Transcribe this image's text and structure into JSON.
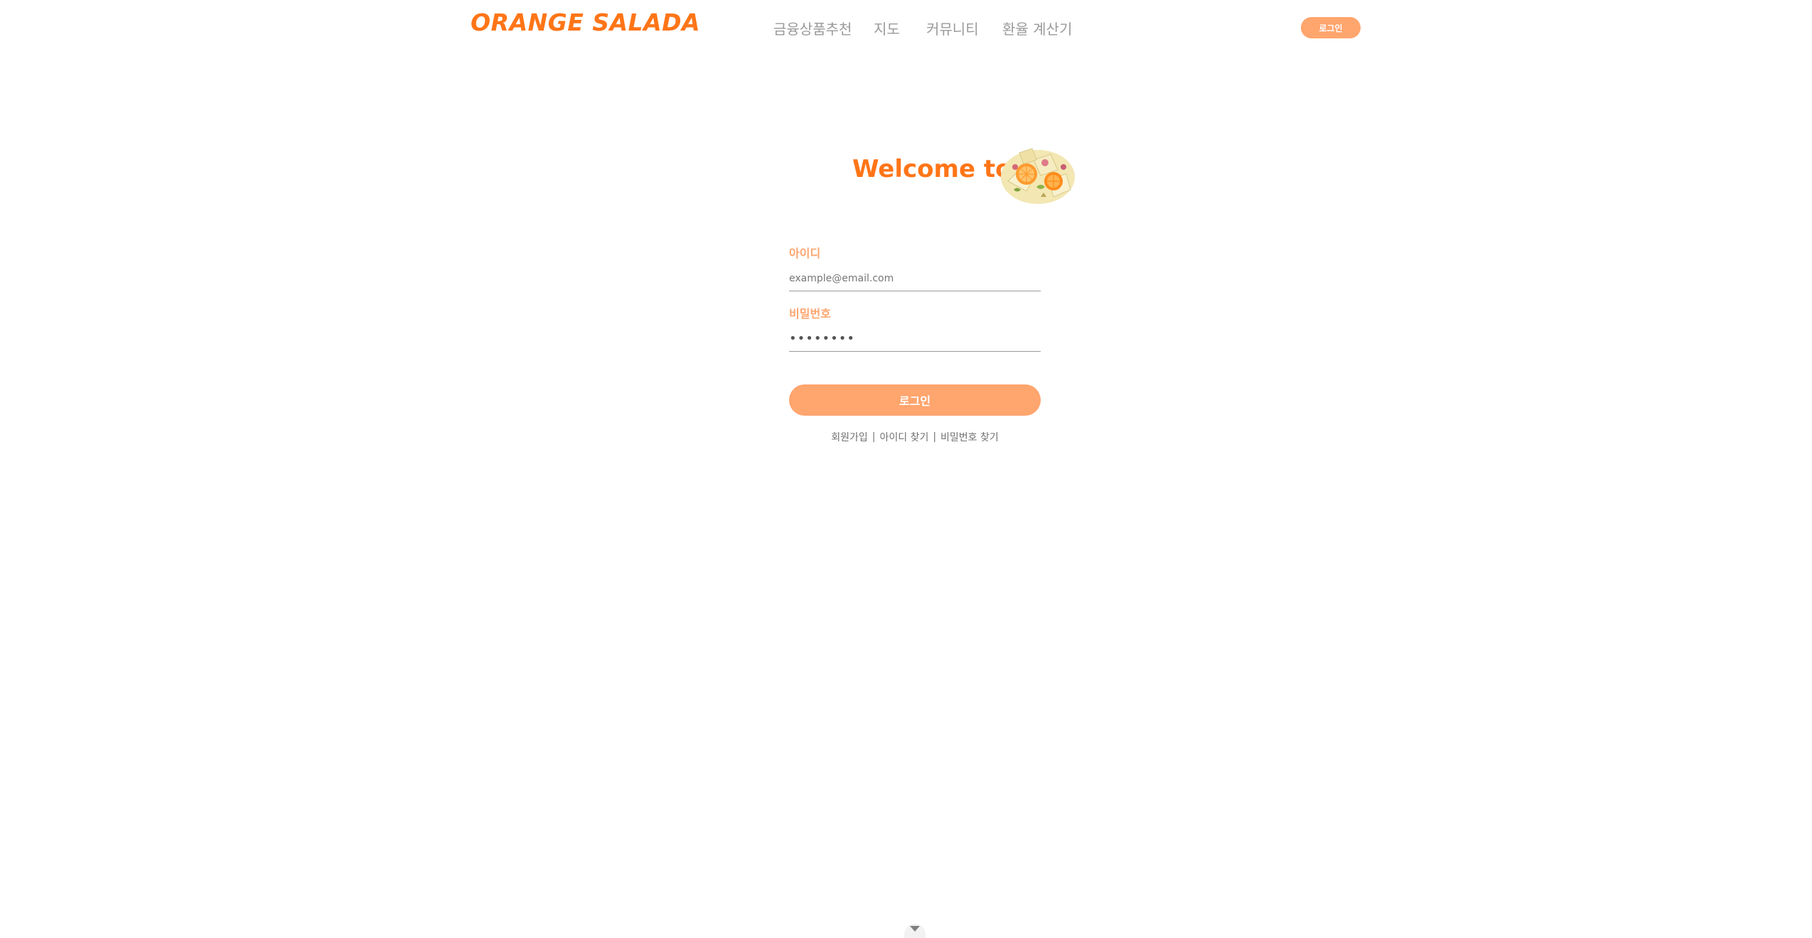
{
  "header": {
    "logo_text": "ORANGE SALADA",
    "nav": [
      "금융상품추천",
      "지도",
      "커뮤니티",
      "환율 계산기"
    ],
    "login_label": "로그인"
  },
  "hero": {
    "welcome_text": "Welcome to",
    "image": "salad-illustration"
  },
  "form": {
    "id_label": "아이디",
    "id_placeholder": "example@email.com",
    "password_label": "비밀번호",
    "password_value": "password",
    "submit_label": "로그인"
  },
  "links": {
    "signup": "회원가입",
    "separator": "|",
    "find_id": "아이디 찾기",
    "find_password": "비밀번호 찾기"
  },
  "footer": {
    "scroll_icon": "chevron-down-icon"
  },
  "colors": {
    "brand": "#ff7517",
    "accent": "#ffa56e",
    "nav_text": "#9a9a9a"
  }
}
